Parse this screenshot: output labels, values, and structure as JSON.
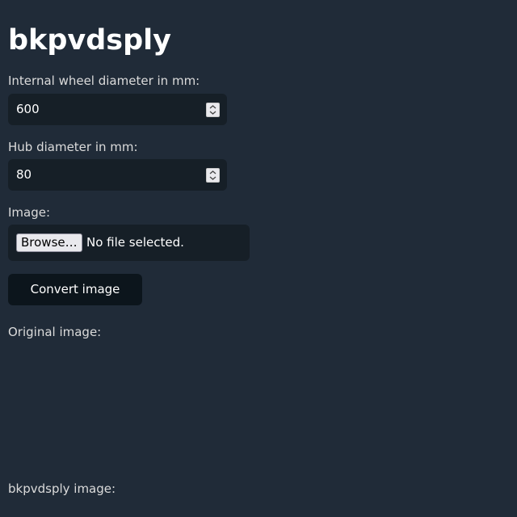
{
  "page": {
    "title": "bkpvdsply"
  },
  "form": {
    "wheel_diameter": {
      "label": "Internal wheel diameter in mm:",
      "value": "600"
    },
    "hub_diameter": {
      "label": "Hub diameter in mm:",
      "value": "80"
    },
    "image": {
      "label": "Image:",
      "browse_label": "Browse…",
      "status": "No file selected."
    },
    "convert_label": "Convert image"
  },
  "output": {
    "original_label": "Original image:",
    "result_label": "bkpvdsply image:"
  },
  "colors": {
    "background": "#202b38",
    "field_background": "#161f27",
    "button_background": "#0c151c",
    "text": "#dbdbdb",
    "heading": "#ffffff"
  },
  "icons": {
    "spinner": "up-down-arrows-icon"
  }
}
